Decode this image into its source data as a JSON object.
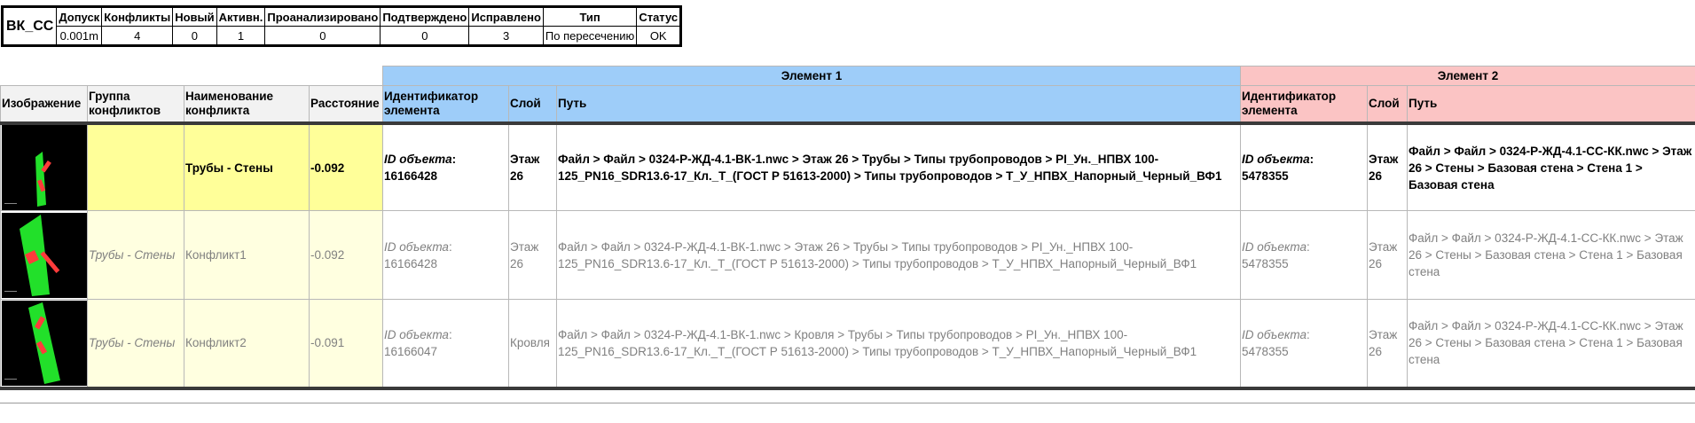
{
  "summary": {
    "test_name": "ВК_СС",
    "headers": [
      "Допуск",
      "Конфликты",
      "Новый",
      "Активн.",
      "Проанализировано",
      "Подтверждено",
      "Исправлено",
      "Тип",
      "Статус"
    ],
    "values": [
      "0.001m",
      "4",
      "0",
      "1",
      "0",
      "0",
      "3",
      "По пересечению",
      "OK"
    ]
  },
  "table": {
    "element1_label": "Элемент 1",
    "element2_label": "Элемент 2",
    "headers": {
      "image": "Изображение",
      "group": "Группа конфликтов",
      "name": "Наименование конфликта",
      "distance": "Расстояние",
      "e1_id": "Идентификатор элемента",
      "e1_layer": "Слой",
      "e1_path": "Путь",
      "e2_id": "Идентификатор элемента",
      "e2_layer": "Слой",
      "e2_path": "Путь"
    },
    "id_label": "ID объекта",
    "rows": [
      {
        "group": "",
        "name": "Трубы - Стены",
        "distance": "-0.092",
        "e1_id": "16166428",
        "e1_layer": "Этаж 26",
        "e1_path": "Файл > Файл > 0324-Р-ЖД-4.1-ВК-1.nwc > Этаж 26 > Трубы > Типы трубопроводов > PI_Ун._НПВХ 100-125_PN16_SDR13.6-17_Кл._T_(ГОСТ Р 51613-2000) > Типы трубопроводов > Т_У_НПВХ_Напорный_Черный_ВФ1",
        "e2_id": "5478355",
        "e2_layer": "Этаж 26",
        "e2_path": "Файл > Файл > 0324-Р-ЖД-4.1-СС-КК.nwc > Этаж 26 > Стены > Базовая стена > Стена 1 > Базовая стена"
      },
      {
        "group": "Трубы - Стены",
        "name": "Конфликт1",
        "distance": "-0.092",
        "e1_id": "16166428",
        "e1_layer": "Этаж 26",
        "e1_path": "Файл > Файл > 0324-Р-ЖД-4.1-ВК-1.nwc > Этаж 26 > Трубы > Типы трубопроводов > PI_Ун._НПВХ 100-125_PN16_SDR13.6-17_Кл._T_(ГОСТ Р 51613-2000) > Типы трубопроводов > Т_У_НПВХ_Напорный_Черный_ВФ1",
        "e2_id": "5478355",
        "e2_layer": "Этаж 26",
        "e2_path": "Файл > Файл > 0324-Р-ЖД-4.1-СС-КК.nwc > Этаж 26 > Стены > Базовая стена > Стена 1 > Базовая стена"
      },
      {
        "group": "Трубы - Стены",
        "name": "Конфликт2",
        "distance": "-0.091",
        "e1_id": "16166047",
        "e1_layer": "Кровля",
        "e1_path": "Файл > Файл > 0324-Р-ЖД-4.1-ВК-1.nwc > Кровля > Трубы > Типы трубопроводов > PI_Ун._НПВХ 100-125_PN16_SDR13.6-17_Кл._T_(ГОСТ Р 51613-2000) > Типы трубопроводов > Т_У_НПВХ_Напорный_Черный_ВФ1",
        "e2_id": "5478355",
        "e2_layer": "Этаж 26",
        "e2_path": "Файл > Файл > 0324-Р-ЖД-4.1-СС-КК.nwc > Этаж 26 > Стены > Базовая стена > Стена 1 > Базовая стена"
      }
    ]
  },
  "colors": {
    "element1": "#9ecdf9",
    "element2": "#fbc4c4",
    "highlight_row": "#ffff99",
    "wall_green": "#22e02a",
    "pipe_red": "#ff3b3b"
  }
}
